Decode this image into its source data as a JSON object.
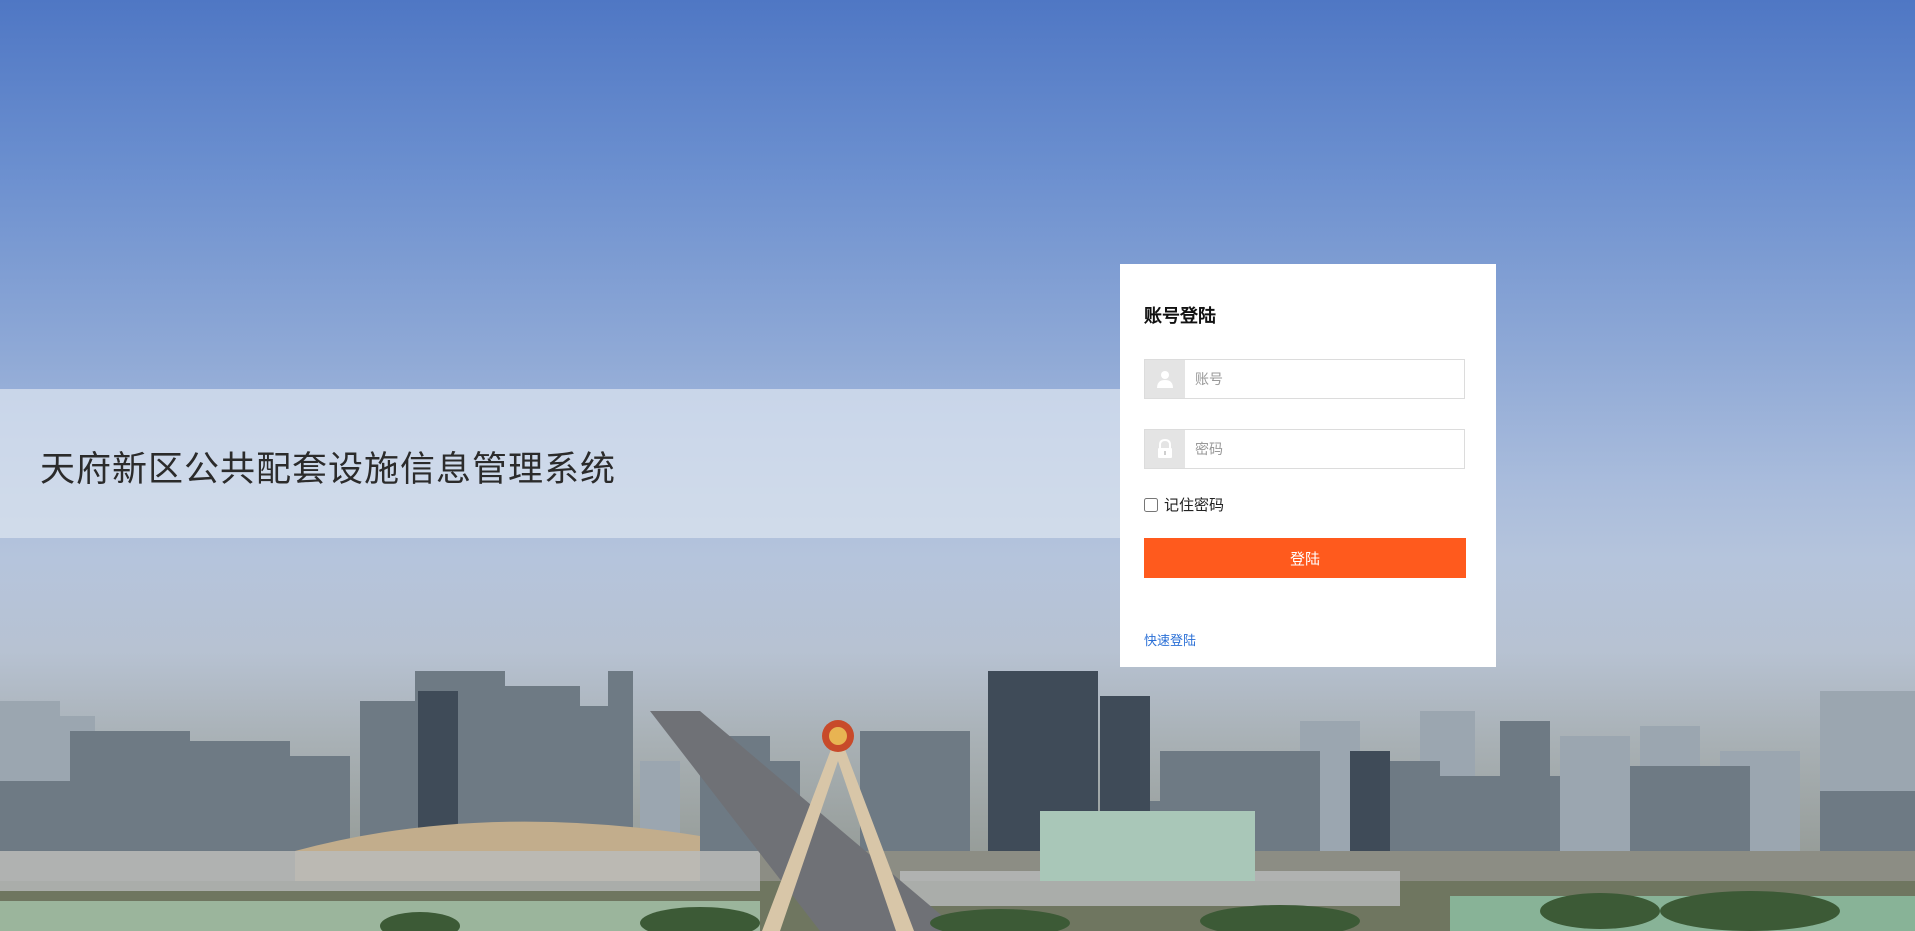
{
  "system_title": "天府新区公共配套设施信息管理系统",
  "login": {
    "heading": "账号登陆",
    "username_placeholder": "账号",
    "password_placeholder": "密码",
    "remember_label": "记住密码",
    "submit_label": "登陆",
    "quick_login_label": "快速登陆"
  },
  "icons": {
    "username": "user-icon",
    "password": "lock-icon"
  },
  "colors": {
    "accent": "#ff5a1d",
    "link": "#2a6fd6"
  }
}
